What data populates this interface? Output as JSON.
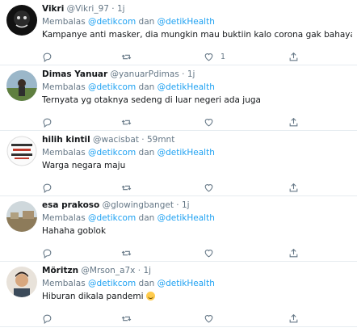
{
  "reply_prefix": "Membalas",
  "conjunction": "dan",
  "tweets": [
    {
      "name": "Vikri",
      "handle": "@Vikri_97",
      "time": "1j",
      "mentions": [
        "@detikcom",
        "@detikHealth"
      ],
      "text": "Kampanye anti masker, dia mungkin mau buktiin kalo corona gak bahaya .",
      "likes": "1",
      "avatar": "dark-masked-figure"
    },
    {
      "name": "Dimas Yanuar",
      "handle": "@yanuarPdimas",
      "time": "1j",
      "mentions": [
        "@detikcom",
        "@detikHealth"
      ],
      "text": "Ternyata yg otaknya sedeng di luar negeri ada juga",
      "likes": "",
      "avatar": "outdoor-photo"
    },
    {
      "name": "hilih kintil",
      "handle": "@wacisbat",
      "time": "59mnt",
      "mentions": [
        "@detikcom",
        "@detikHealth"
      ],
      "text": "Warga negara maju",
      "likes": "",
      "avatar": "text-sticker"
    },
    {
      "name": "esa prakoso",
      "handle": "@glowingbanget",
      "time": "1j",
      "mentions": [
        "@detikcom",
        "@detikHealth"
      ],
      "text": "Hahaha goblok",
      "likes": "",
      "avatar": "landscape-photo"
    },
    {
      "name": "Möritzn",
      "handle": "@Mrson_a7x",
      "time": "1j",
      "mentions": [
        "@detikcom",
        "@detikHealth"
      ],
      "text": "Hiburan dikala pandemi",
      "likes": "",
      "avatar": "face-photo"
    }
  ],
  "icons": {
    "reply": "reply-icon",
    "retweet": "retweet-icon",
    "like": "heart-icon",
    "share": "share-icon",
    "emoji": "grinning-face-icon"
  },
  "colors": {
    "link": "#1da1f2",
    "secondary": "#657786",
    "divider": "#e6ecf0"
  }
}
